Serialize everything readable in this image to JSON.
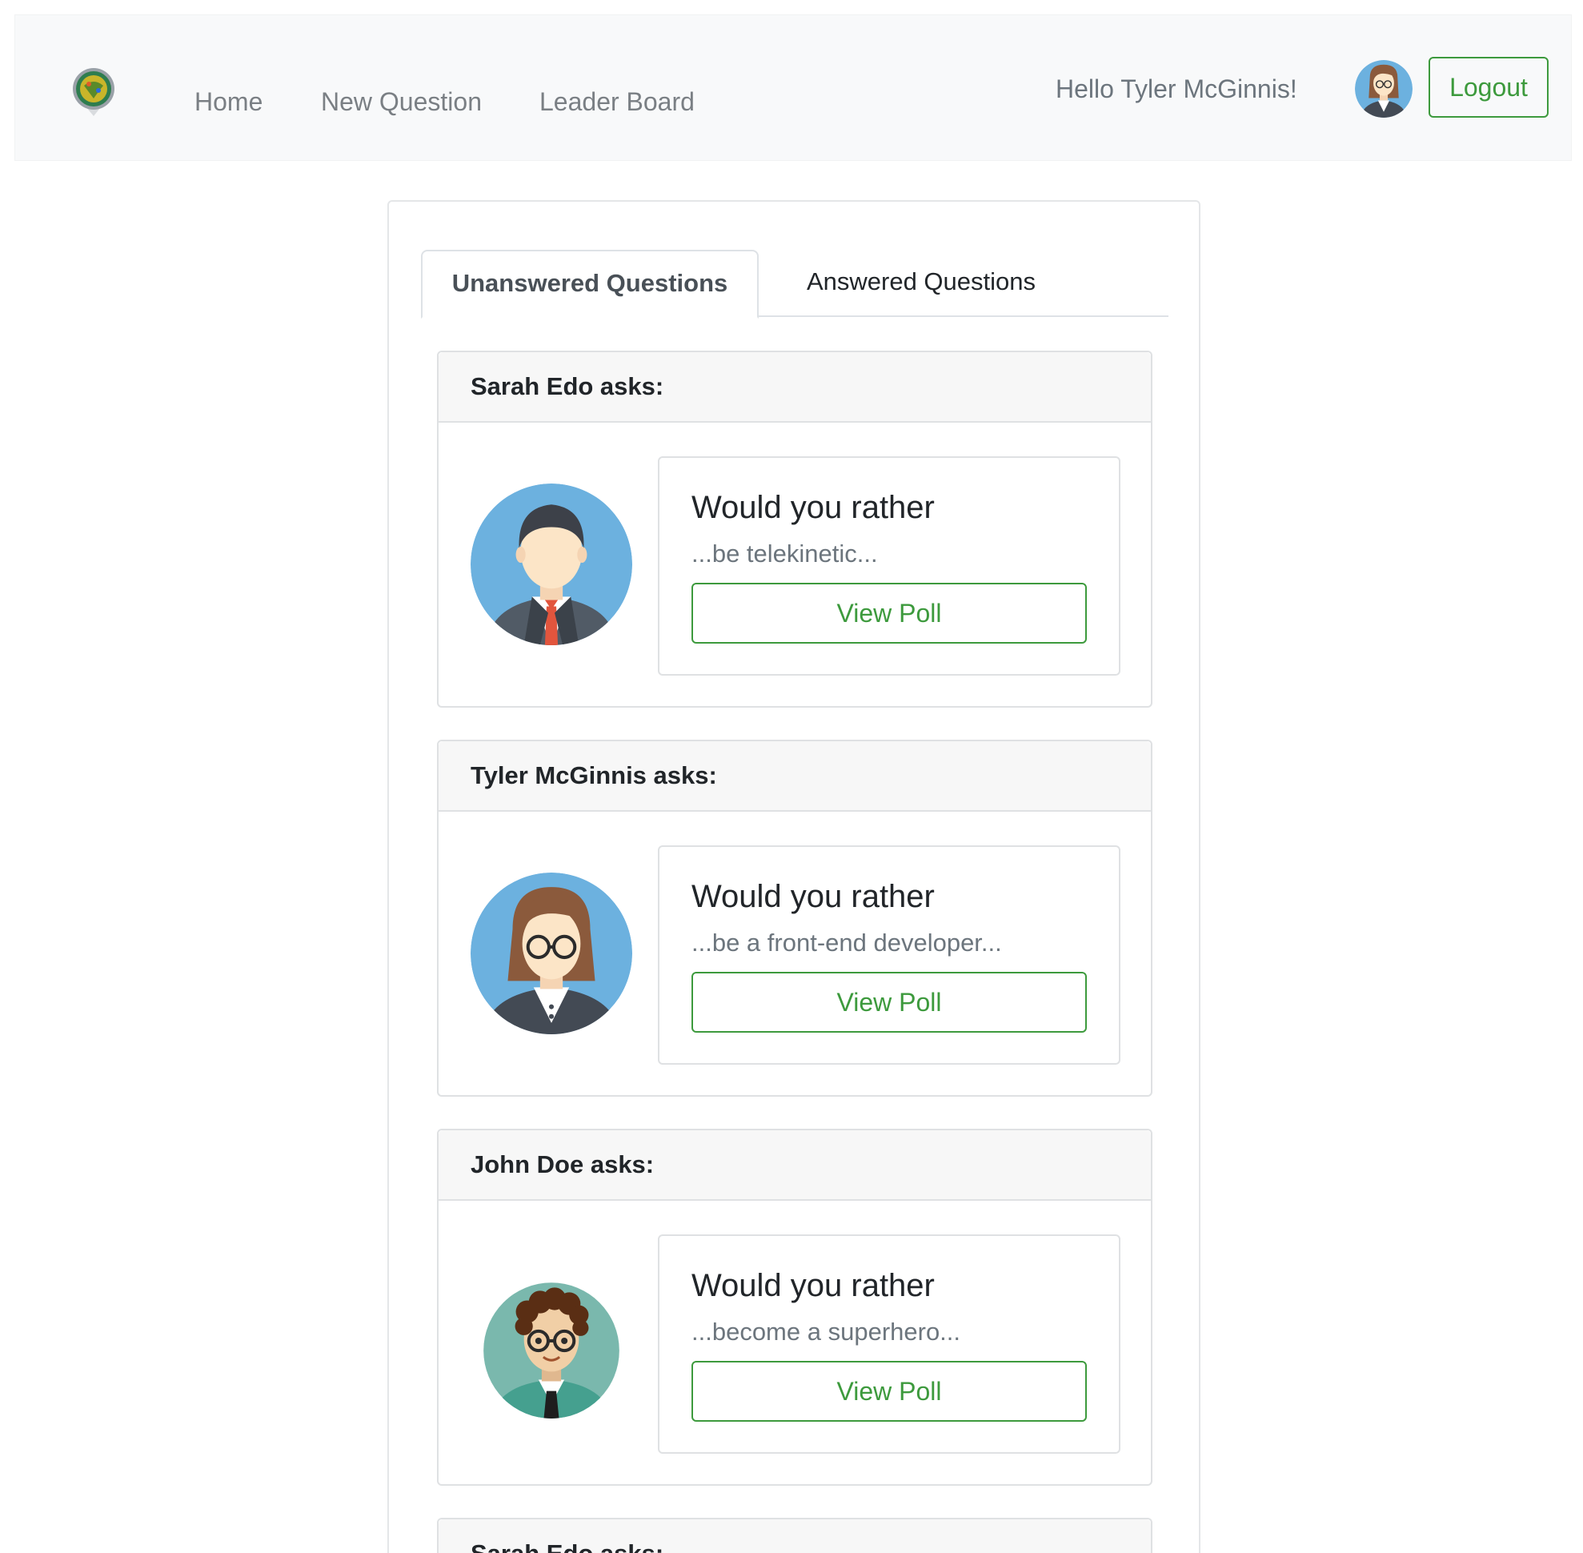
{
  "navbar": {
    "logo_icon": "app-logo-icon",
    "links": [
      {
        "label": "Home"
      },
      {
        "label": "New Question"
      },
      {
        "label": "Leader Board"
      }
    ],
    "greeting": "Hello Tyler McGinnis!",
    "avatar_icon": "user-avatar-icon",
    "logout_label": "Logout"
  },
  "tabs": {
    "active_label": "Unanswered Questions",
    "inactive_label": "Answered Questions"
  },
  "questions": [
    {
      "header": "Sarah Edo asks:",
      "title": "Would you rather",
      "teaser": "...be telekinetic...",
      "button": "View Poll",
      "avatar": "man-avatar-icon"
    },
    {
      "header": "Tyler McGinnis asks:",
      "title": "Would you rather",
      "teaser": "...be a front-end developer...",
      "button": "View Poll",
      "avatar": "woman-avatar-icon"
    },
    {
      "header": "John Doe asks:",
      "title": "Would you rather",
      "teaser": "...become a superhero...",
      "button": "View Poll",
      "avatar": "curly-man-avatar-icon"
    },
    {
      "header": "Sarah Edo asks:"
    }
  ],
  "colors": {
    "accent_green": "#3d9a3d",
    "navbar_bg": "#f8f9fa",
    "avatar_blue": "#6cb1df",
    "avatar_teal": "#7ab8ad"
  }
}
